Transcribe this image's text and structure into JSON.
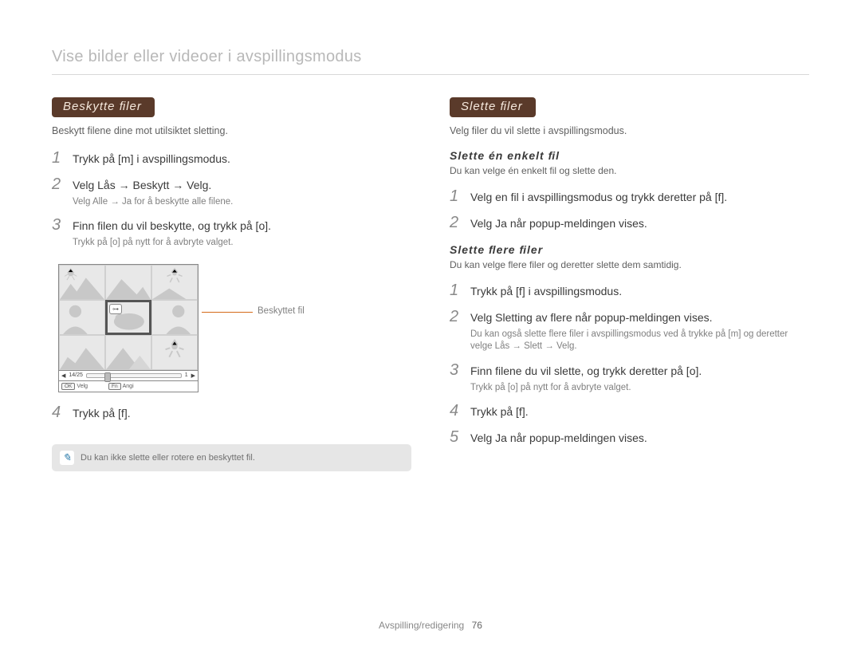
{
  "page_title": "Vise bilder eller videoer i avspillingsmodus",
  "left": {
    "heading": "Beskytte ﬁler",
    "intro": "Beskytt ﬁlene dine mot utilsiktet sletting.",
    "steps": [
      {
        "text": "Trykk på [m] i avspillingsmodus."
      },
      {
        "text": "Velg Lås → Beskytt → Velg.",
        "sub": "Velg Alle → Ja for å beskytte alle ﬁlene."
      },
      {
        "text": "Finn ﬁlen du vil beskytte, og trykk på [o].",
        "sub": "Trykk på [o] på nytt for å avbryte valget."
      },
      {
        "text": "Trykk på [f]."
      }
    ],
    "callout": "Beskyttet ﬁl",
    "ctrlbar_count": "14/25",
    "ctrlbar_one": "1",
    "btn_ok": "OK",
    "btn_velg": "Velg",
    "btn_fn": "Fn",
    "btn_angi": "Angi",
    "info": "Du kan ikke slette eller rotere en beskyttet ﬁl."
  },
  "right": {
    "heading": "Slette ﬁler",
    "intro": "Velg ﬁler du vil slette i avspillingsmodus.",
    "block1": {
      "sub": "Slette én enkelt ﬁl",
      "intro": "Du kan velge én enkelt ﬁl og slette den.",
      "steps": [
        {
          "text": "Velg en ﬁl i avspillingsmodus og trykk deretter på [f]."
        },
        {
          "text": "Velg Ja når popup-meldingen vises."
        }
      ]
    },
    "block2": {
      "sub": "Slette ﬂere ﬁler",
      "intro": "Du kan velge ﬂere ﬁler og deretter slette dem samtidig.",
      "steps": [
        {
          "text": "Trykk på [f] i avspillingsmodus."
        },
        {
          "text": "Velg Sletting av ﬂere når popup-meldingen vises.",
          "sub": "Du kan også slette ﬂere ﬁler i avspillingsmodus ved å trykke på [m] og deretter velge Lås → Slett → Velg."
        },
        {
          "text": "Finn ﬁlene du vil slette, og trykk deretter på [o].",
          "sub": "Trykk på [o] på nytt for å avbryte valget."
        },
        {
          "text": "Trykk på [f]."
        },
        {
          "text": "Velg Ja når popup-meldingen vises."
        }
      ]
    }
  },
  "footer": {
    "section": "Avspilling/redigering",
    "page": "76"
  }
}
